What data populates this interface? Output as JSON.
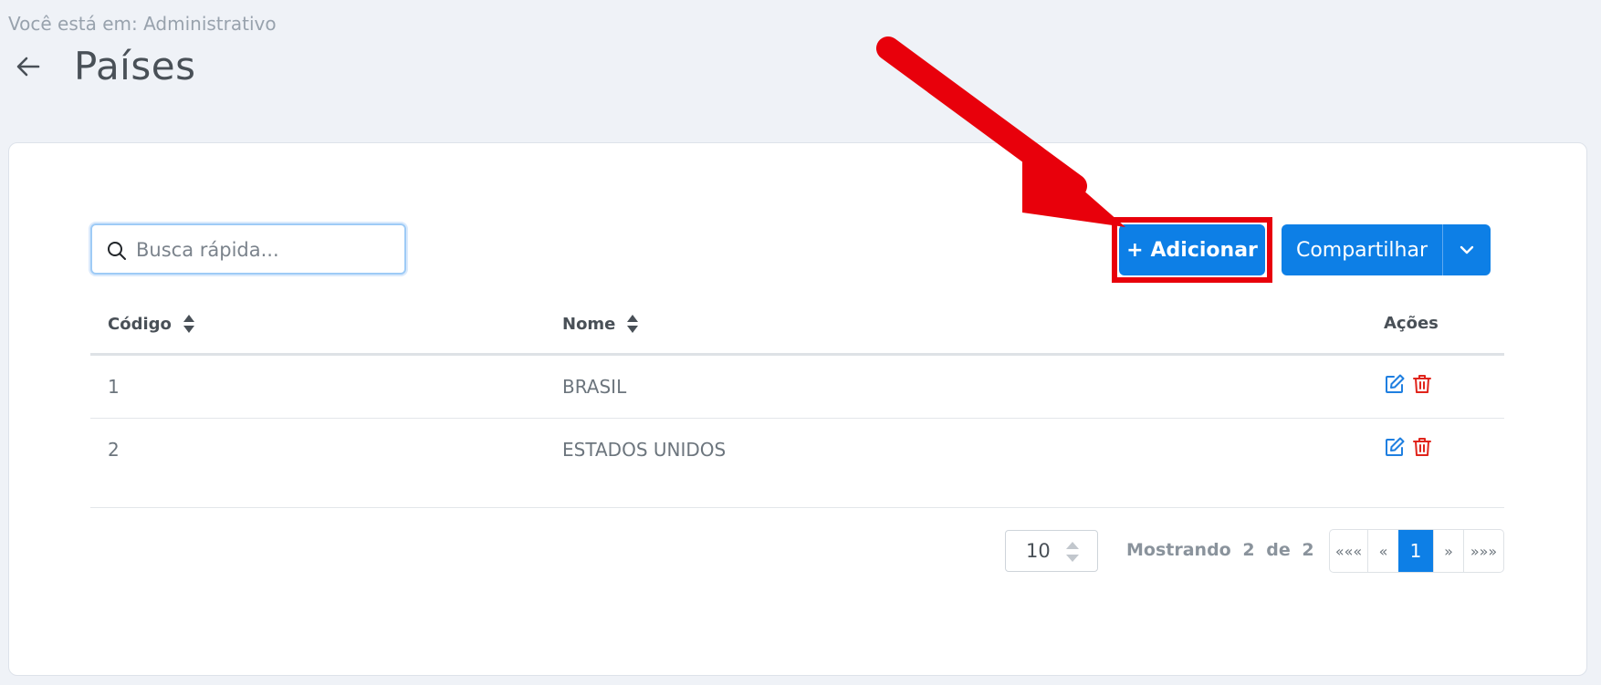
{
  "breadcrumb": "Você está em: Administrativo",
  "page_title": "Países",
  "search": {
    "placeholder": "Busca rápida..."
  },
  "toolbar": {
    "add_label": "Adicionar",
    "add_prefix": "+",
    "share_label": "Compartilhar"
  },
  "table": {
    "columns": [
      "Código",
      "Nome",
      "Ações"
    ],
    "rows": [
      {
        "codigo": "1",
        "nome": "BRASIL"
      },
      {
        "codigo": "2",
        "nome": "ESTADOS UNIDOS"
      }
    ]
  },
  "pagination": {
    "page_size": "10",
    "showing_word": "Mostrando",
    "showing_count": "2",
    "showing_of": "de",
    "showing_total": "2",
    "first": "«««",
    "prev": "«",
    "current": "1",
    "next": "»",
    "last": "»»»"
  },
  "colors": {
    "primary": "#0d7fe6",
    "edit_icon": "#1f7fe0",
    "delete_icon": "#e0241b",
    "annotation": "#e8000b"
  },
  "icons": [
    "back-arrow-icon",
    "search-icon",
    "sort-icon",
    "chevron-down-icon",
    "edit-icon",
    "trash-icon"
  ]
}
